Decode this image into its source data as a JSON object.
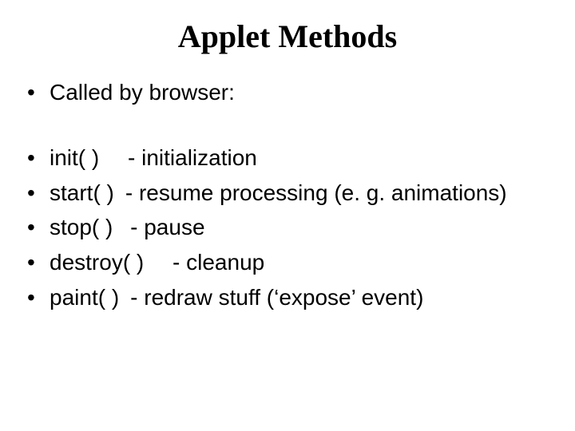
{
  "title": "Applet Methods",
  "bullets_top": [
    "Called by browser:"
  ],
  "bullets_main": [
    "init( )  - initialization",
    "start( ) - resume processing (e. g. animations)",
    "stop( )  - pause",
    "destroy( )  - cleanup",
    "paint( ) - redraw stuff (‘expose’ event)"
  ]
}
